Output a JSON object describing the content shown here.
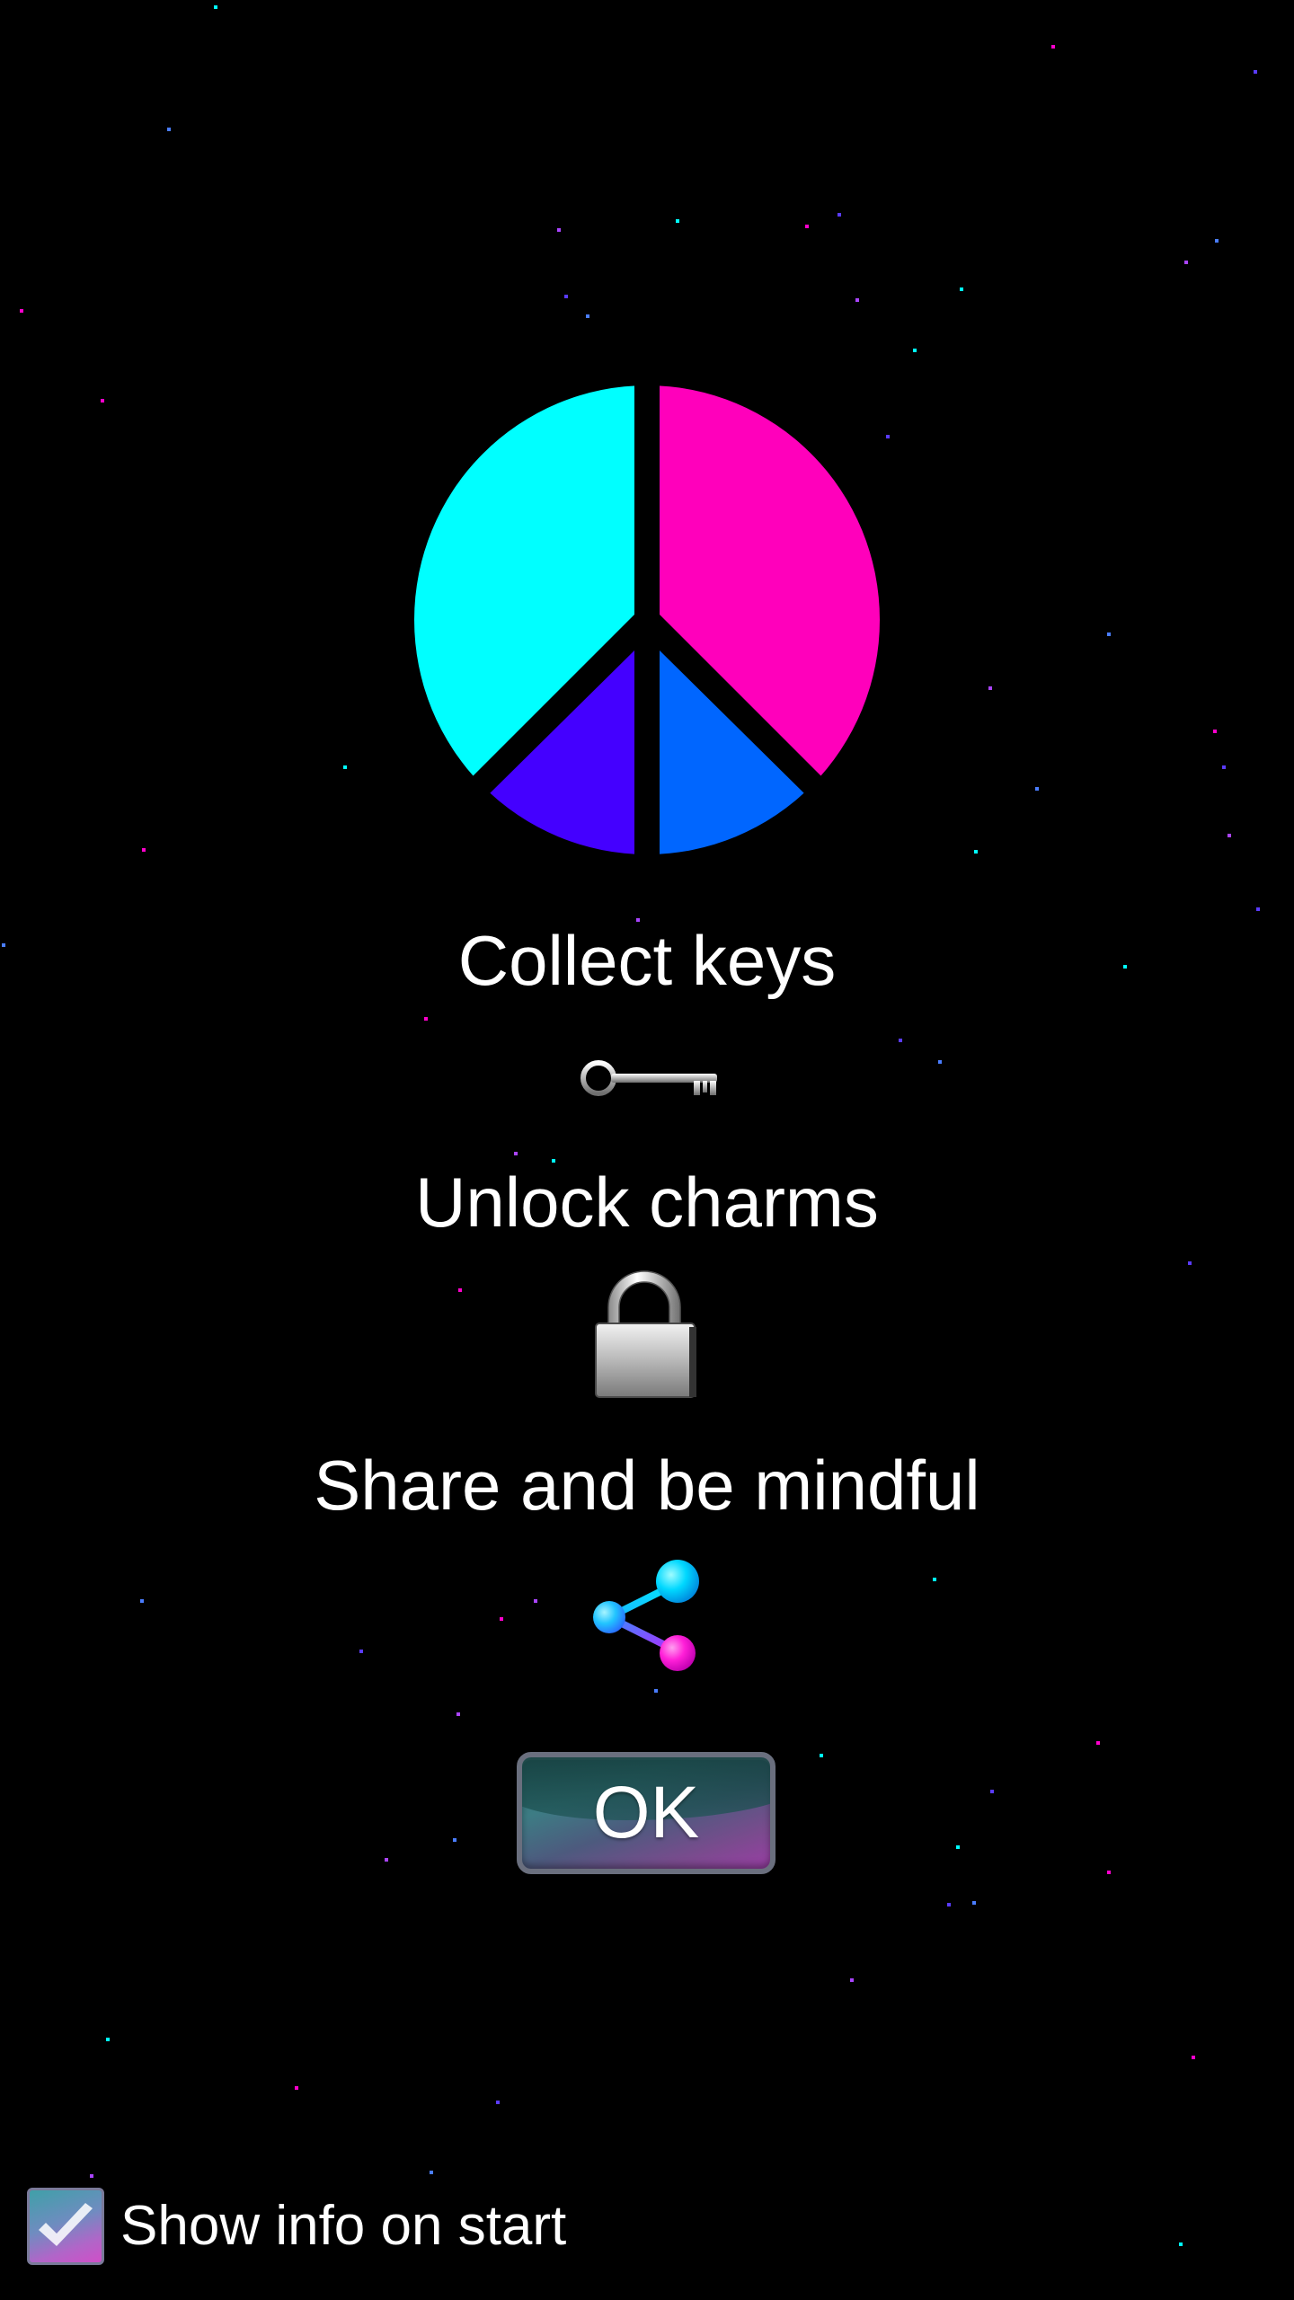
{
  "screen": {
    "background_color": "#000000",
    "star_colors": [
      "#00ffff",
      "#ff00cc",
      "#5a3bff",
      "#4a7dff",
      "#aa44ff"
    ]
  },
  "emblem": {
    "icon": "peace-symbol-icon",
    "colors": {
      "top_left": "#00ffff",
      "top_right": "#ff00bb",
      "bottom_left": "#4400ff",
      "bottom_right": "#0066ff"
    }
  },
  "info": {
    "collect_label": "Collect keys",
    "collect_icon": "key-icon",
    "unlock_label": "Unlock charms",
    "unlock_icon": "padlock-icon",
    "share_label": "Share and be mindful",
    "share_icon": "share-icon"
  },
  "ok_button": {
    "label": "OK"
  },
  "show_info": {
    "label": "Show info on start",
    "checked": true
  }
}
